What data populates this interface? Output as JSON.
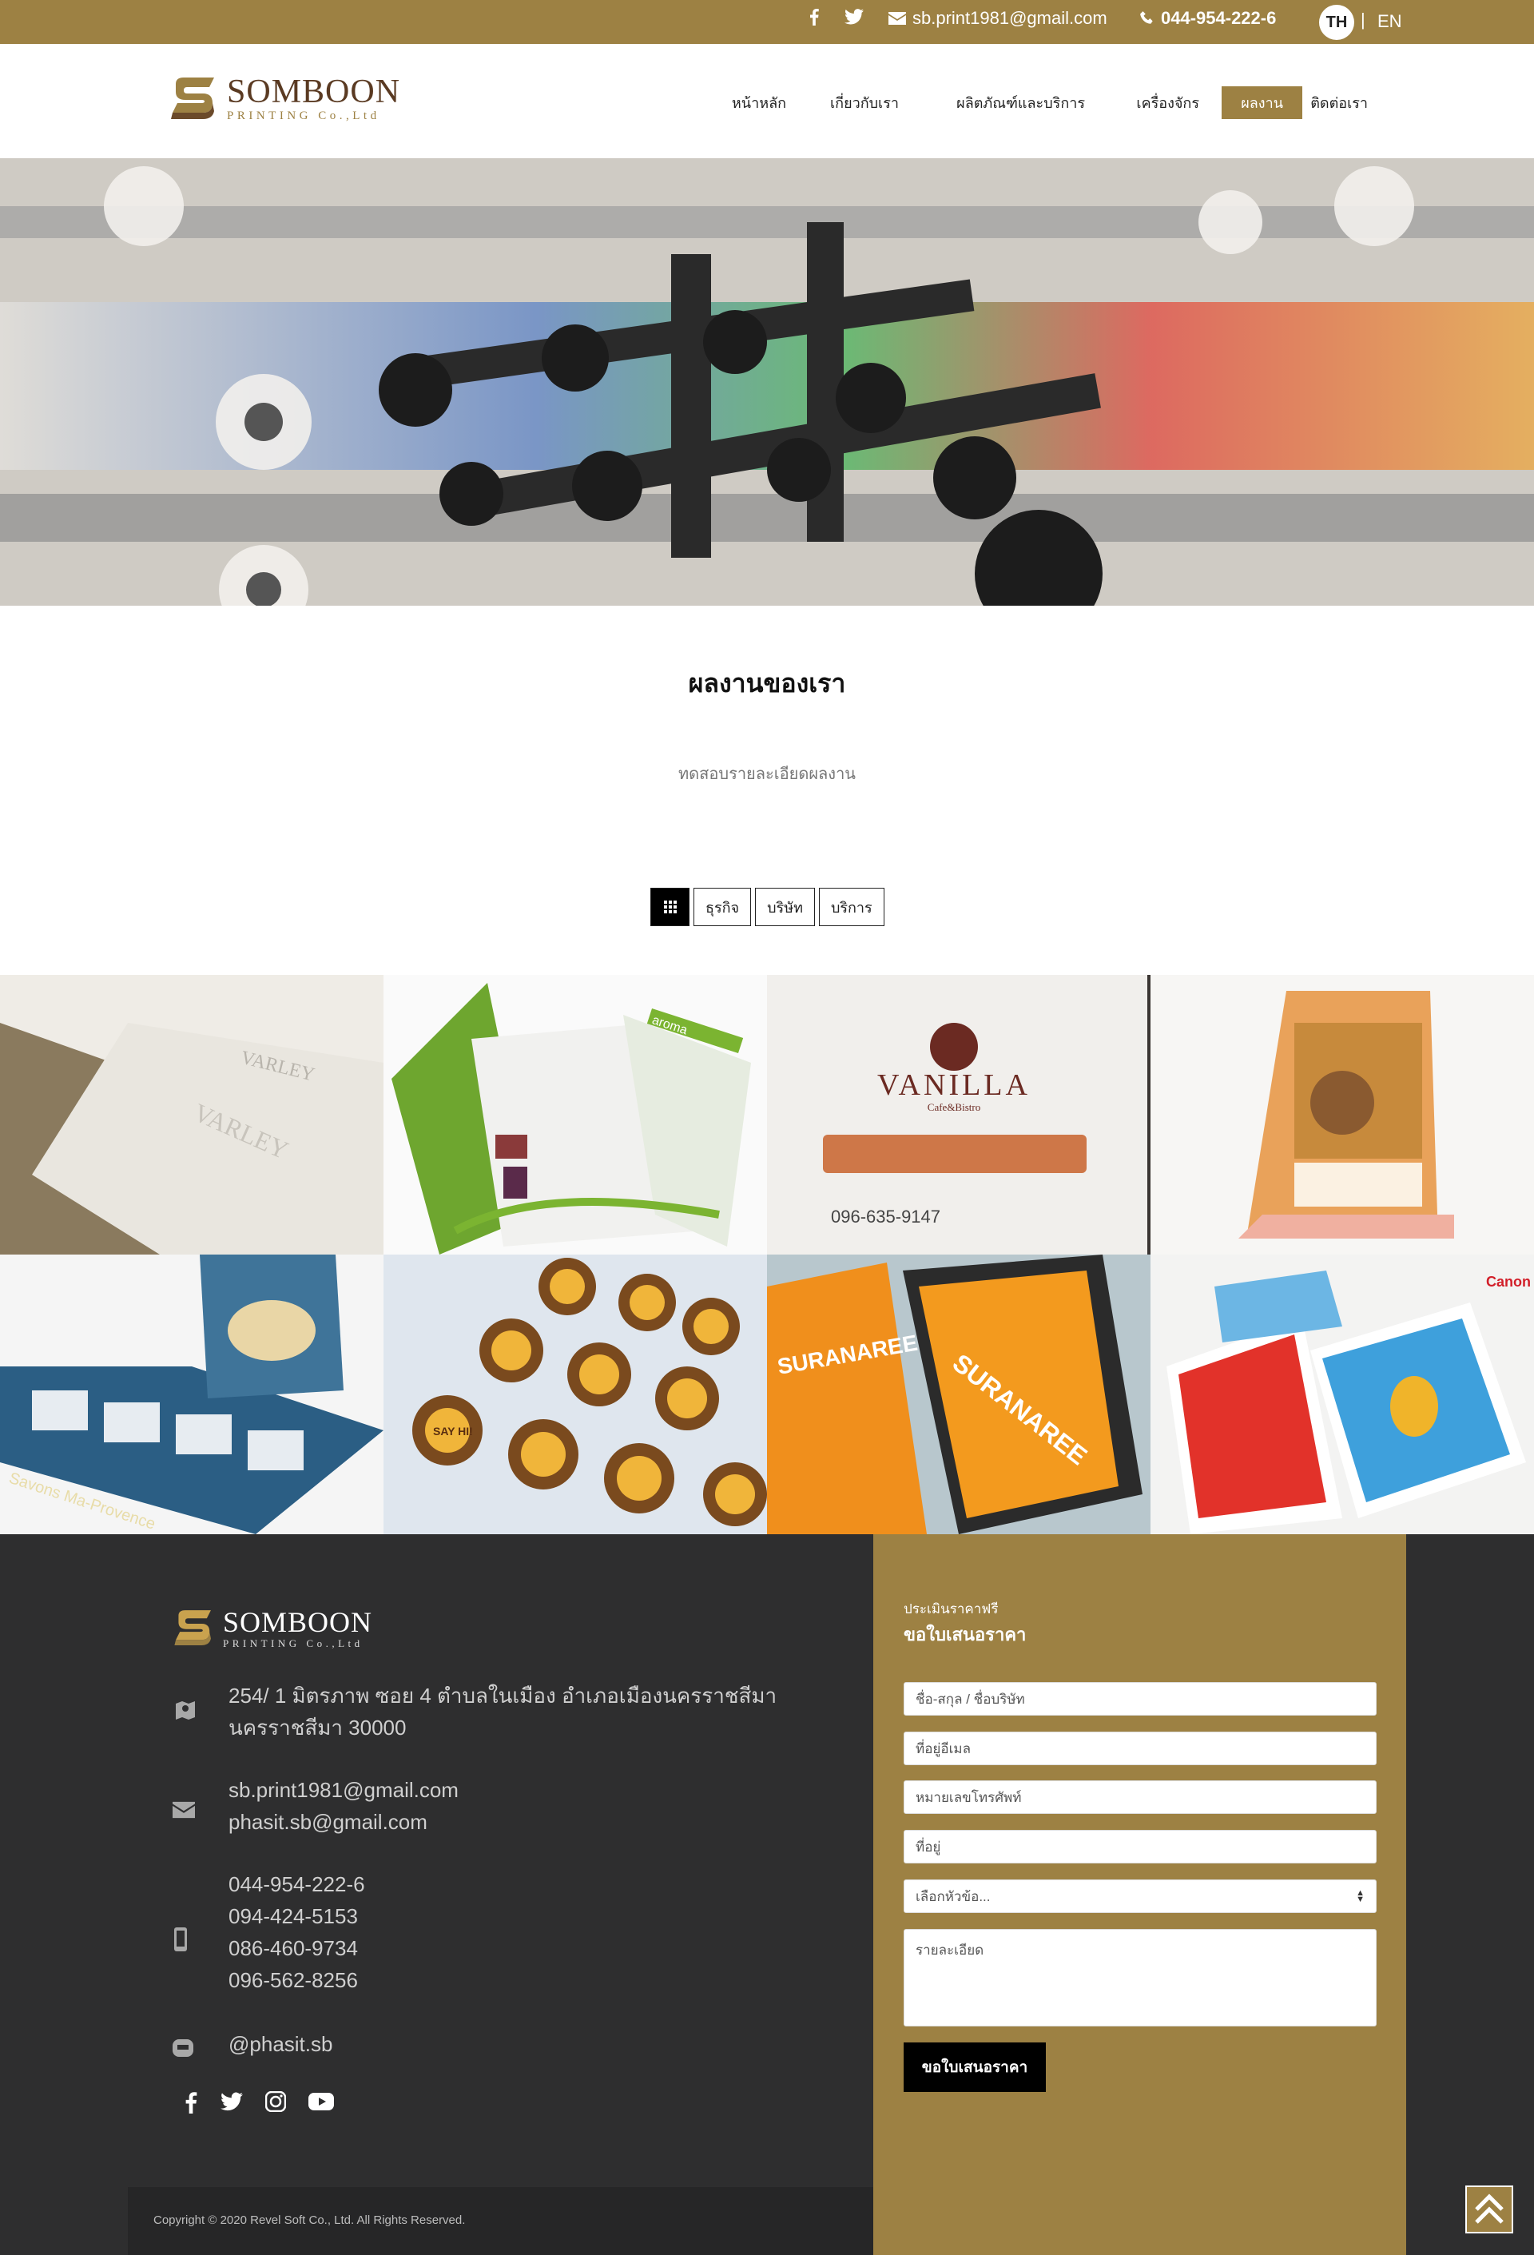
{
  "topbar": {
    "email": "sb.print1981@gmail.com",
    "phone": "044-954-222-6",
    "lang_th": "TH",
    "lang_sep": "|",
    "lang_en": "EN",
    "icons": [
      "facebook-icon",
      "twitter-icon",
      "envelope-icon",
      "phone-icon"
    ]
  },
  "brand": {
    "name": "SOMBOON",
    "tagline": "PRINTING Co.,Ltd",
    "colors": {
      "gold": "#9d8143",
      "brown": "#5a3a22"
    }
  },
  "nav": {
    "items": [
      {
        "label": "หน้าหลัก"
      },
      {
        "label": "เกี่ยวกับเรา"
      },
      {
        "label": "ผลิตภัณฑ์และบริการ"
      },
      {
        "label": "เครื่องจักร"
      },
      {
        "label": "ผลงาน",
        "active": true
      },
      {
        "label": "ติดต่อเรา"
      }
    ]
  },
  "section": {
    "title": "ผลงานของเรา",
    "subtitle": "ทดสอบรายละเอียดผลงาน"
  },
  "filters": {
    "all_icon": "grid-icon",
    "items": [
      "ธุรกิจ",
      "บริษัท",
      "บริการ"
    ]
  },
  "portfolio": {
    "tiles": [
      {
        "name": "business-cards-varley",
        "text": "VARLEY"
      },
      {
        "name": "aroma-brochure",
        "text": "aroma"
      },
      {
        "name": "vanilla-menu",
        "text": "VANILLA"
      },
      {
        "name": "desk-calendar",
        "text": ""
      },
      {
        "name": "soap-box-packaging",
        "text": "Savons Ma-Provence"
      },
      {
        "name": "sticker-labels",
        "text": "SAY HI!"
      },
      {
        "name": "suranaree-folder",
        "text": "SURANAREE"
      },
      {
        "name": "photo-prints",
        "text": "Canon"
      }
    ]
  },
  "footer": {
    "address": [
      "254/ 1 มิตรภาพ ซอย 4 ตำบลในเมือง อำเภอเมืองนครราชสีมา",
      "นครราชสีมา 30000"
    ],
    "emails": [
      "sb.print1981@gmail.com",
      "phasit.sb@gmail.com"
    ],
    "phones": [
      "044-954-222-6",
      "094-424-5153",
      "086-460-9734",
      "096-562-8256"
    ],
    "line": "@phasit.sb",
    "social": [
      "facebook-icon",
      "twitter-icon",
      "instagram-icon",
      "youtube-icon"
    ],
    "copyright": "Copyright © 2020 Revel Soft Co., Ltd. All Rights Reserved."
  },
  "quote_form": {
    "label_small": "ประเมินราคาฟรี",
    "label_big": "ขอใบเสนอราคา",
    "name_placeholder": "ชื่อ-สกุล / ชื่อบริษัท",
    "email_placeholder": "ที่อยู่อีเมล",
    "phone_placeholder": "หมายเลขโทรศัพท์",
    "address_placeholder": "ที่อยู่",
    "topic_select": "เลือกหัวข้อ...",
    "detail_placeholder": "รายละเอียด",
    "submit_label": "ขอใบเสนอราคา"
  }
}
